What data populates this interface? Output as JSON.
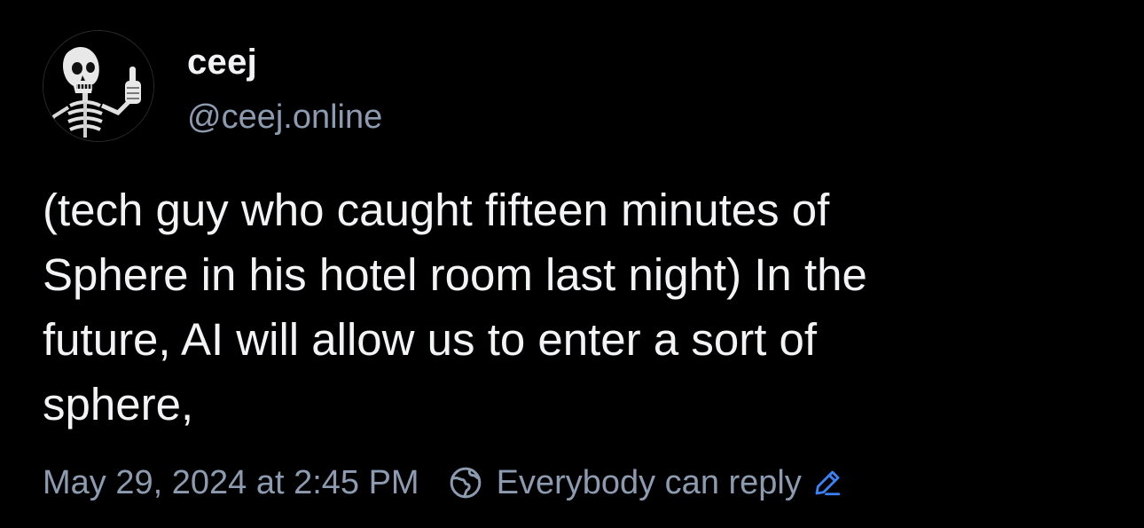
{
  "author": {
    "display_name": "ceej",
    "handle": "@ceej.online",
    "avatar": "skeleton-thumbs-up-avatar"
  },
  "post": {
    "text": "(tech guy who caught fifteen minutes of\nSphere in his hotel room last night) In the\nfuture, AI will allow us to enter a sort of\nsphere,",
    "timestamp": "May 29, 2024 at 2:45 PM",
    "reply_setting": "Everybody can reply"
  },
  "icons": {
    "reply_setting": "globe-icon",
    "edit": "pencil-edit-icon"
  },
  "colors": {
    "background": "#000000",
    "text": "#f1f3f5",
    "muted": "#8d9bb0",
    "accent": "#3b82f6"
  }
}
